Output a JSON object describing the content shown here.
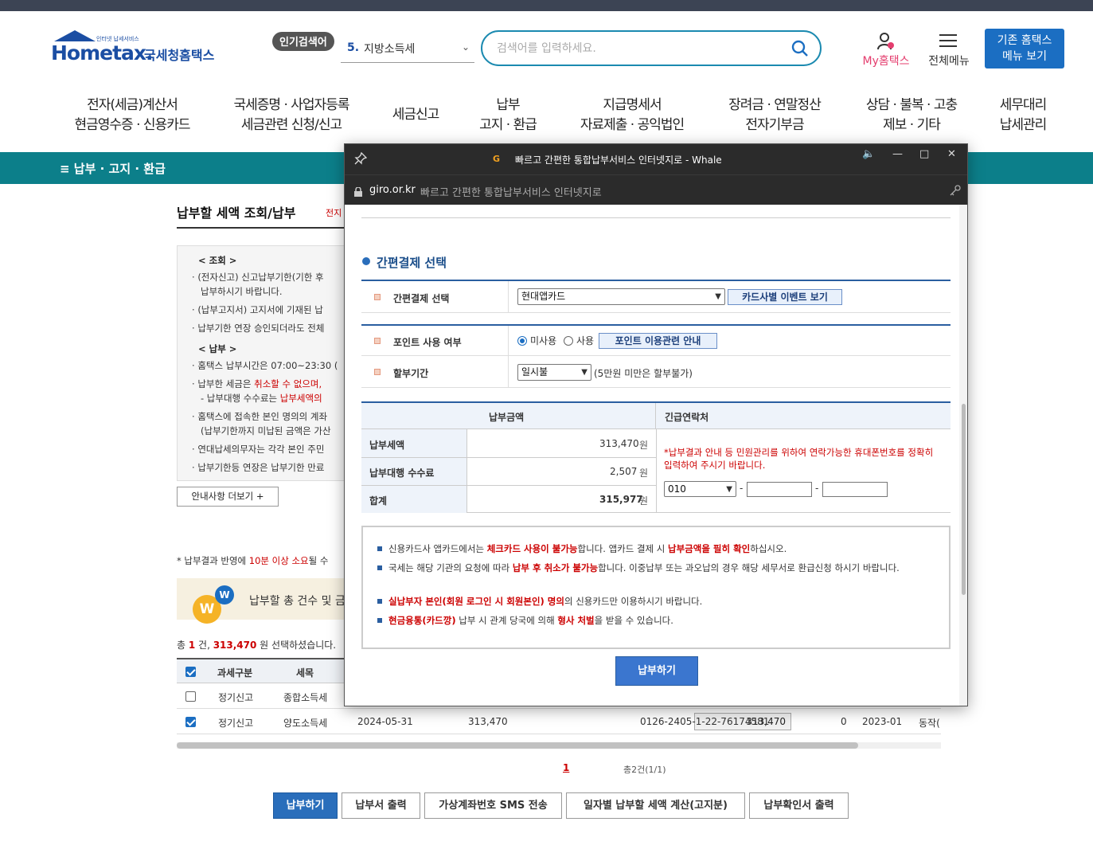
{
  "header": {
    "logo_main": "Hometax.",
    "logo_ko": "국세청홈택스",
    "logo_sub": "인터넷 납세서비스",
    "popular_label": "인기검색어",
    "popular_rank": "5.",
    "popular_term": "지방소득세",
    "search_placeholder": "검색어를 입력하세요.",
    "my_label": "My홈택스",
    "allmenu_label": "전체메뉴",
    "old_menu_line1": "기존 홈택스",
    "old_menu_line2": "메뉴 보기"
  },
  "gnb": [
    {
      "line1": "전자(세금)계산서",
      "line2": "현금영수증 · 신용카드"
    },
    {
      "line1": "국세증명 · 사업자등록",
      "line2": "세금관련 신청/신고"
    },
    {
      "line1": "세금신고",
      "line2": ""
    },
    {
      "line1": "납부",
      "line2": "고지 · 환급"
    },
    {
      "line1": "지급명세서",
      "line2": "자료제출 · 공익법인"
    },
    {
      "line1": "장려금 · 연말정산",
      "line2": "전자기부금"
    },
    {
      "line1": "상담 · 불복 · 고충",
      "line2": "제보 · 기타"
    },
    {
      "line1": "세무대리",
      "line2": "납세관리"
    }
  ],
  "subbar": {
    "title": "≡  납부 · 고지 · 환급"
  },
  "page": {
    "title": "납부할 세액 조회/납부",
    "title_suffix": "전지",
    "info": {
      "h1": "< 조회 >",
      "l1": "(전자신고) 신고납부기한(기한 후",
      "l1b": "납부하시기 바랍니다.",
      "l2": "(납부고지서) 고지서에 기재된 납",
      "l3": "납부기한 연장 승인되더라도 전체",
      "h2": "< 납부 >",
      "l4": "홈택스 납부시간은 07:00~23:30 (",
      "l5a": "납부한 세금은 ",
      "l5b": "취소할 수 없으며,",
      "l6a": "- 납부대행 수수료는 ",
      "l6b": "납부세액의",
      "l7": "홈택스에 접속한 본인 명의의 계좌",
      "l7b": "(납부기한까지 미납된 금액은 가산",
      "l8": "연대납세의무자는 각각 본인 주민",
      "l9": "납부기한등 연장은 납부기한 만료"
    },
    "more_btn": "안내사항 더보기 +",
    "note_a": "* 납부결과 반영에 ",
    "note_b": "10분 이상 소요",
    "note_c": "될 수",
    "banner_text": "납부할 총 건수 및 금",
    "sum_a": "총 ",
    "sum_count": "1",
    "sum_b": " 건, ",
    "sum_amount": "313,470",
    "sum_c": " 원 선택하셨습니다.",
    "table_headers": [
      "과세구분",
      "세목"
    ],
    "rows": [
      {
        "type": "정기신고",
        "tax": "종합소득세",
        "due": "",
        "amount": "",
        "pay": "",
        "num": "",
        "extra": "",
        "ym": "",
        "office": ""
      },
      {
        "type": "정기신고",
        "tax": "양도소득세",
        "due": "2024-05-31",
        "amount": "313,470",
        "pay": "313,470",
        "num": "0126-2405-1-22-76174581",
        "extra": "0",
        "ym": "2023-01",
        "office": "동작("
      }
    ],
    "pager_current": "1",
    "pager_total": "총2건(1/1)",
    "buttons": [
      "납부하기",
      "납부서 출력",
      "가상계좌번호 SMS 전송",
      "일자별 납부할 세액 계산(고지분)",
      "납부확인서 출력"
    ]
  },
  "popup": {
    "window_title": "빠르고 간편한 통합납부서비스 인터넷지로 - Whale",
    "domain": "giro.or.kr",
    "page_title": "빠르고 간편한 통합납부서비스 인터넷지로",
    "section_title": "간편결제 선택",
    "easy_pay_label": "간편결제 선택",
    "easy_pay_value": "현대앱카드",
    "event_btn": "카드사별 이벤트 보기",
    "point_label": "포인트 사용 여부",
    "point_no": "미사용",
    "point_yes": "사용",
    "point_btn": "포인트 이용관련 안내",
    "install_label": "할부기간",
    "install_value": "일시불",
    "install_note": "(5만원 미만은 할부불가)",
    "pay_amount_header": "납부금액",
    "contact_header": "긴급연락처",
    "tax_label": "납부세액",
    "tax_value": "313,470",
    "fee_label": "납부대행 수수료",
    "fee_value": "2,507",
    "total_label": "합계",
    "total_value": "315,977",
    "won": "원",
    "contact_note": "*납부결과 안내 등 민원관리를 위하여 연락가능한 휴대폰번호를 정확히 입력하여 주시기 바랍니다.",
    "phone_prefix": "010",
    "phone_dash": "-",
    "notes": [
      {
        "a": "신용카드사 앱카드에서는 ",
        "b": "체크카드 사용이 불가능",
        "c": "합니다. 앱카드 결제 시 ",
        "d": "납부금액을 필히 확인",
        "e": "하십시오."
      },
      {
        "a": "국세는 해당 기관의 요청에 따라 ",
        "b": "납부 후 취소가 불가능",
        "c": "합니다. 이중납부 또는 과오납의 경우 해당 세무서로 환급신청 하시기 바랍니다.",
        "d": "",
        "e": ""
      },
      {
        "a": "",
        "b": "실납부자 본인(회원 로그인 시 회원본인) 명의",
        "c": "의 신용카드만 이용하시기 바랍니다.",
        "d": "",
        "e": ""
      },
      {
        "a": "",
        "b": "현금융통(카드깡)",
        "c": " 납부 시 관계 당국에 의해 ",
        "d": "형사 처벌",
        "e": "을 받을 수 있습니다."
      }
    ],
    "pay_btn": "납부하기"
  }
}
